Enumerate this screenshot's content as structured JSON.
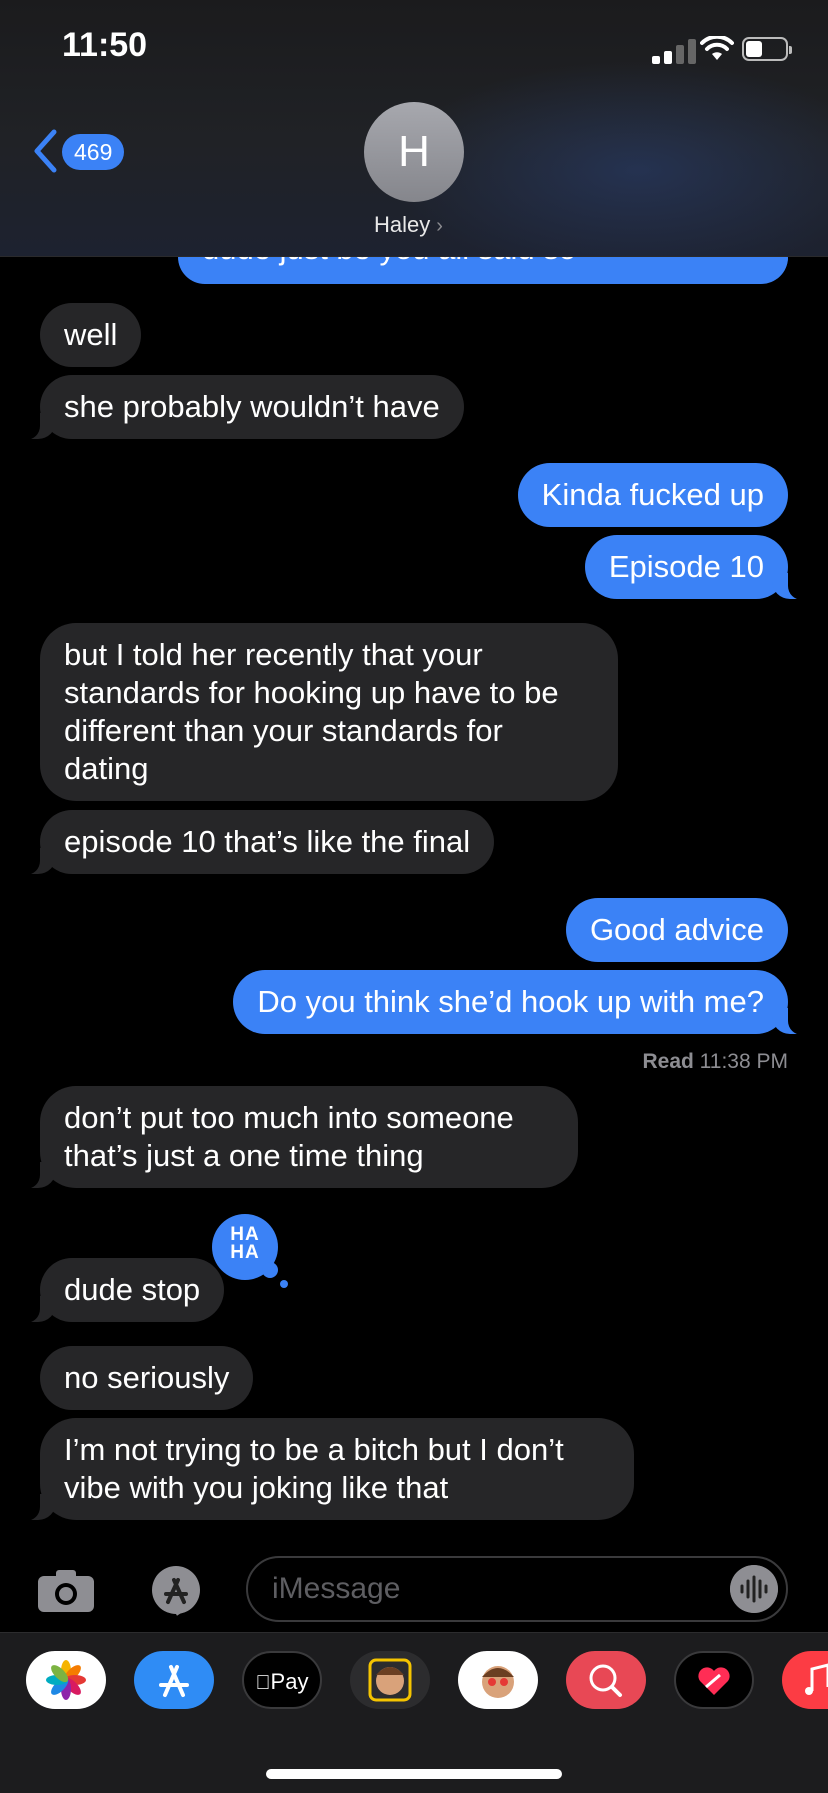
{
  "status_bar": {
    "time": "11:50"
  },
  "header": {
    "back_count": "469",
    "avatar_initial": "H",
    "contact_name": "Haley",
    "contact_chevron": "›"
  },
  "messages": [
    {
      "from": "me",
      "text": "dude just be you all said so"
    },
    {
      "from": "them",
      "text": "well"
    },
    {
      "from": "them",
      "text": "she probably wouldn’t have"
    },
    {
      "from": "me",
      "text": "Kinda fucked up"
    },
    {
      "from": "me",
      "text": "Episode 10"
    },
    {
      "from": "them",
      "text": "but I told her recently that your standards for hooking up have to be different than your standards for dating"
    },
    {
      "from": "them",
      "text": "episode 10 that’s like the final"
    },
    {
      "from": "me",
      "text": "Good advice"
    },
    {
      "from": "me",
      "text": "Do you think she’d hook up with me?"
    },
    {
      "from": "them",
      "text": "don’t put too much into someone that’s just a one time thing"
    },
    {
      "from": "them",
      "text": "dude stop"
    },
    {
      "from": "them",
      "text": "no seriously"
    },
    {
      "from": "them",
      "text": "I’m not trying to be a bitch but I don’t vibe with you joking like that"
    }
  ],
  "read_receipt": {
    "label": "Read",
    "time": "11:38 PM"
  },
  "tapback": {
    "line1": "HA",
    "line2": "HA"
  },
  "input": {
    "placeholder": "iMessage"
  },
  "app_drawer": [
    {
      "name": "photos-app-icon",
      "label": ""
    },
    {
      "name": "app-store-icon",
      "label": ""
    },
    {
      "name": "apple-pay-icon",
      "label": "Pay"
    },
    {
      "name": "memoji-icon",
      "label": ""
    },
    {
      "name": "memoji-stickers-icon",
      "label": ""
    },
    {
      "name": "images-search-icon",
      "label": ""
    },
    {
      "name": "digital-touch-icon",
      "label": ""
    },
    {
      "name": "music-icon",
      "label": ""
    }
  ],
  "colors": {
    "blue": "#3b82f6",
    "incoming": "#262628",
    "background": "#000000"
  }
}
